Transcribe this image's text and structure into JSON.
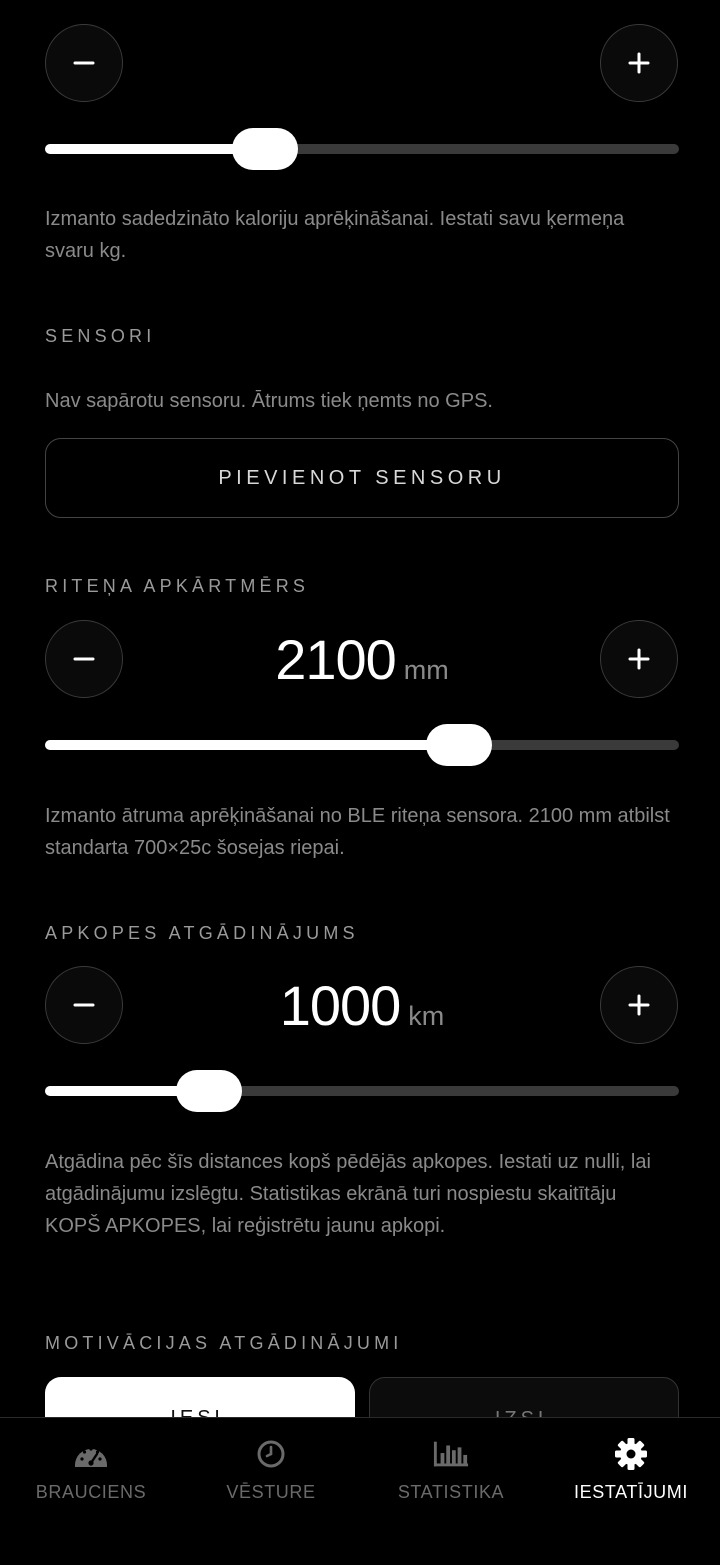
{
  "weight": {
    "slider_fraction": 0.33,
    "help": "Izmanto sadedzināto kaloriju aprēķināšanai. Iestati savu ķermeņa svaru kg."
  },
  "sensors": {
    "title": "SENSORI",
    "status": "Nav sapārotu sensoru. Ātrums tiek ņemts no GPS.",
    "add_button": "PIEVIENOT SENSORU"
  },
  "wheel": {
    "title": "RITEŅA APKĀRTMĒRS",
    "value": "2100",
    "unit": "mm",
    "slider_fraction": 0.67,
    "help": "Izmanto ātruma aprēķināšanai no BLE riteņa sensora. 2100 mm atbilst standarta 700×25c šosejas riepai."
  },
  "service": {
    "title": "APKOPES ATGĀDINĀJUMS",
    "value": "1000",
    "unit": "km",
    "slider_fraction": 0.23,
    "help": "Atgādina pēc šīs distances kopš pēdējās apkopes. Iestati uz nulli, lai atgādinājumu izslēgtu. Statistikas ekrānā turi nospiestu skaitītāju KOPŠ APKOPES, lai reģistrētu jaunu apkopi."
  },
  "motivation": {
    "title": "MOTIVĀCIJAS ATGĀDINĀJUMI",
    "on_label": "IESL",
    "off_label": "IZSL"
  },
  "tabs": [
    {
      "label": "BRAUCIENS",
      "icon": "speedometer-icon"
    },
    {
      "label": "VĒSTURE",
      "icon": "clock-icon"
    },
    {
      "label": "STATISTIKA",
      "icon": "bar-chart-icon"
    },
    {
      "label": "IESTATĪJUMI",
      "icon": "gear-icon"
    }
  ],
  "active_tab": 3,
  "colors": {
    "accent": "#ffffff",
    "muted": "#8a8a8a",
    "background": "#000000"
  }
}
